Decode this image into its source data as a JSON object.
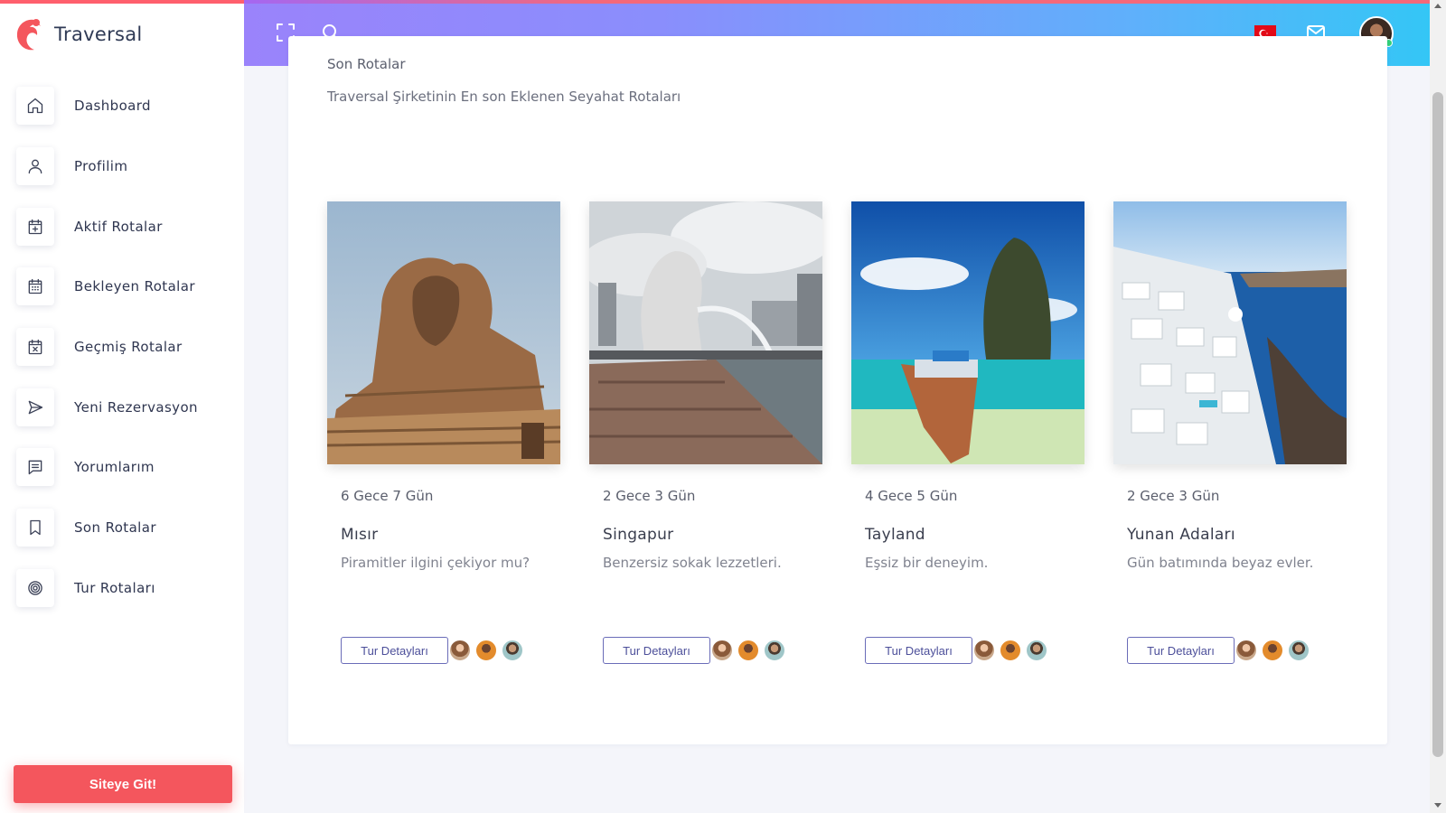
{
  "app": {
    "brand_name": "Traversal",
    "brand_color": "#f4565d"
  },
  "sidebar": {
    "items": [
      {
        "label": "Dashboard",
        "icon": "home-icon"
      },
      {
        "label": "Profilim",
        "icon": "user-icon"
      },
      {
        "label": "Aktif Rotalar",
        "icon": "calendar-plus-icon"
      },
      {
        "label": "Bekleyen Rotalar",
        "icon": "calendar-grid-icon"
      },
      {
        "label": "Geçmiş Rotalar",
        "icon": "calendar-x-icon"
      },
      {
        "label": "Yeni Rezervasyon",
        "icon": "send-icon"
      },
      {
        "label": "Yorumlarım",
        "icon": "comment-icon"
      },
      {
        "label": "Son Rotalar",
        "icon": "bookmark-icon"
      },
      {
        "label": "Tur Rotaları",
        "icon": "target-icon"
      }
    ],
    "site_button_label": "Siteye Git!"
  },
  "header": {
    "icons": [
      "fullscreen-icon",
      "search-icon",
      "turkey-flag-icon",
      "mail-icon",
      "user-avatar"
    ]
  },
  "main": {
    "title": "Son Rotalar",
    "subtitle": "Traversal Şirketinin En son Eklenen Seyahat Rotaları",
    "tours": [
      {
        "duration": "6 Gece 7 Gün",
        "name": "Mısır",
        "description": "Piramitler ilgini çekiyor mu?",
        "button": "Tur Detayları",
        "image": "sphinx-image"
      },
      {
        "duration": "2 Gece 3 Gün",
        "name": "Singapur",
        "description": "Benzersiz sokak lezzetleri.",
        "button": "Tur Detayları",
        "image": "merlion-image"
      },
      {
        "duration": "4 Gece 5 Gün",
        "name": "Tayland",
        "description": "Eşsiz bir deneyim.",
        "button": "Tur Detayları",
        "image": "longtail-boat-image"
      },
      {
        "duration": "2 Gece 3 Gün",
        "name": "Yunan Adaları",
        "description": "Gün batımında beyaz evler.",
        "button": "Tur Detayları",
        "image": "santorini-image"
      }
    ]
  }
}
